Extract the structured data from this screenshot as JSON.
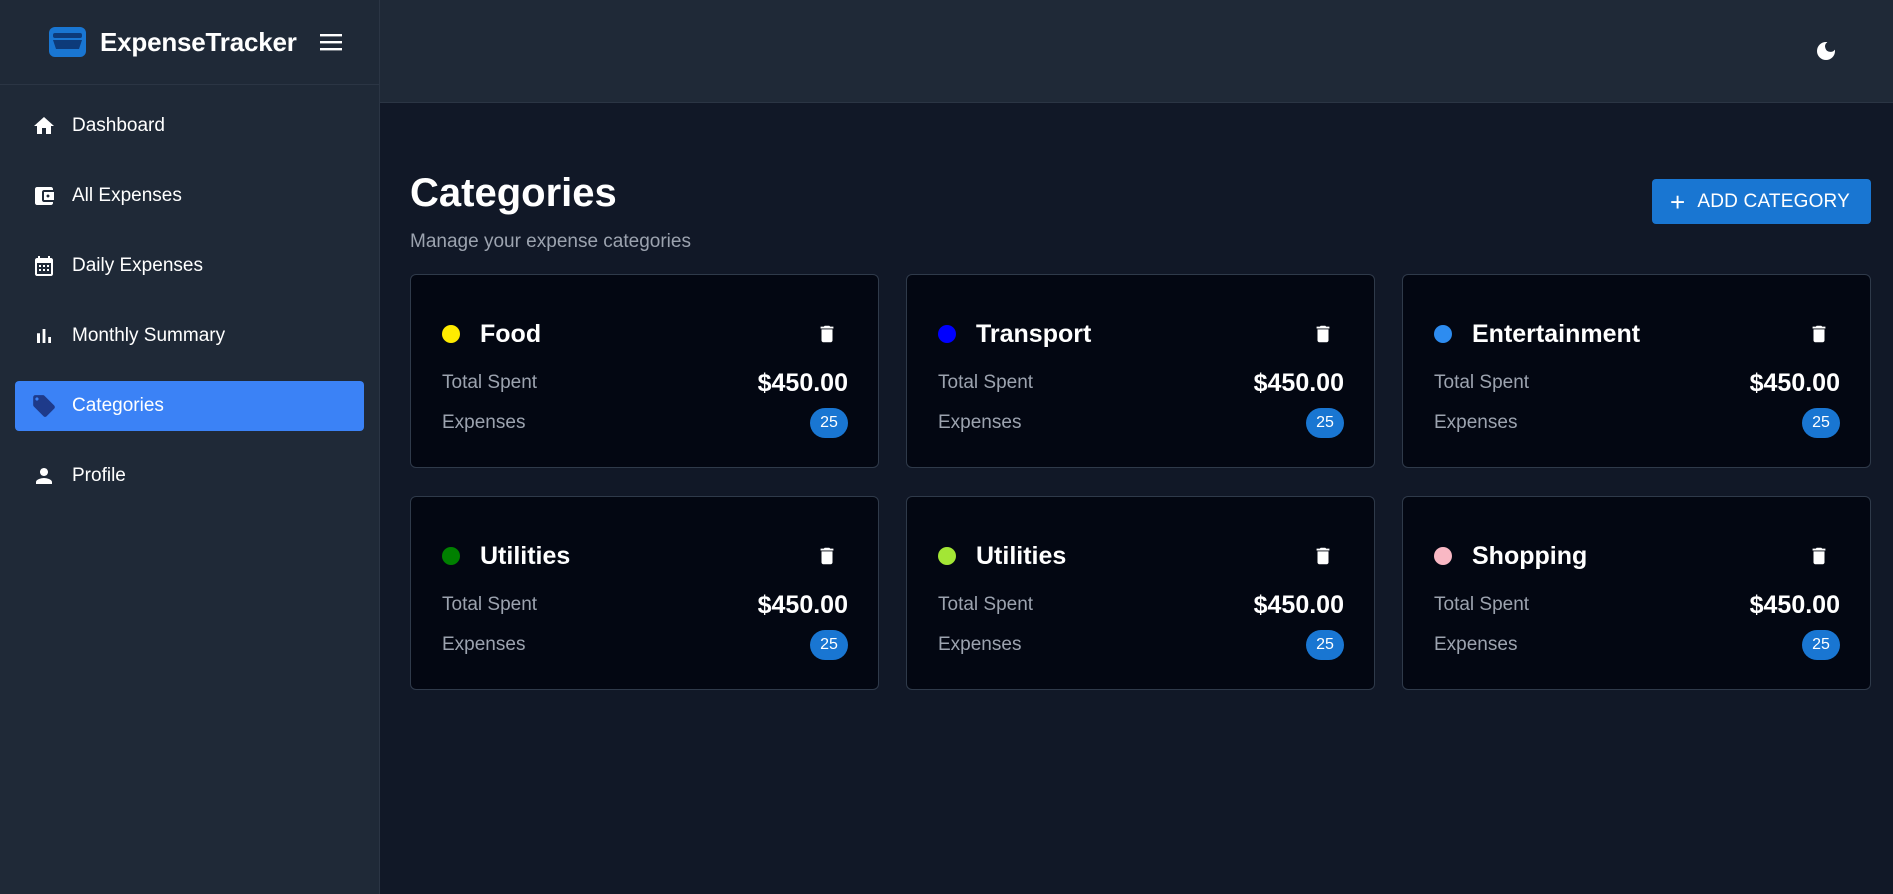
{
  "brand": {
    "name": "ExpenseTracker"
  },
  "sidebar": {
    "items": [
      {
        "label": "Dashboard",
        "icon": "home-icon",
        "active": false
      },
      {
        "label": "All Expenses",
        "icon": "wallet-icon",
        "active": false
      },
      {
        "label": "Daily Expenses",
        "icon": "calendar-icon",
        "active": false
      },
      {
        "label": "Monthly Summary",
        "icon": "bar-chart-icon",
        "active": false
      },
      {
        "label": "Categories",
        "icon": "tag-icon",
        "active": true
      },
      {
        "label": "Profile",
        "icon": "user-icon",
        "active": false
      }
    ]
  },
  "topbar": {
    "theme_icon": "moon-icon"
  },
  "page": {
    "title": "Categories",
    "subtitle": "Manage your expense categories",
    "add_button_label": "ADD CATEGORY"
  },
  "card_labels": {
    "total_spent": "Total Spent",
    "expenses": "Expenses"
  },
  "categories": [
    {
      "name": "Food",
      "color": "#ffeb00",
      "total_spent": "$450.00",
      "expenses": "25"
    },
    {
      "name": "Transport",
      "color": "#0000ff",
      "total_spent": "$450.00",
      "expenses": "25"
    },
    {
      "name": "Entertainment",
      "color": "#2d8cf0",
      "total_spent": "$450.00",
      "expenses": "25"
    },
    {
      "name": "Utilities",
      "color": "#008000",
      "total_spent": "$450.00",
      "expenses": "25"
    },
    {
      "name": "Utilities",
      "color": "#a3e635",
      "total_spent": "$450.00",
      "expenses": "25"
    },
    {
      "name": "Shopping",
      "color": "#f9b8c4",
      "total_spent": "$450.00",
      "expenses": "25"
    }
  ],
  "colors": {
    "accent": "#3b82f6",
    "button": "#1976d2",
    "sidebar_bg": "#1f2937",
    "main_bg": "#111827",
    "card_bg": "#030712"
  }
}
